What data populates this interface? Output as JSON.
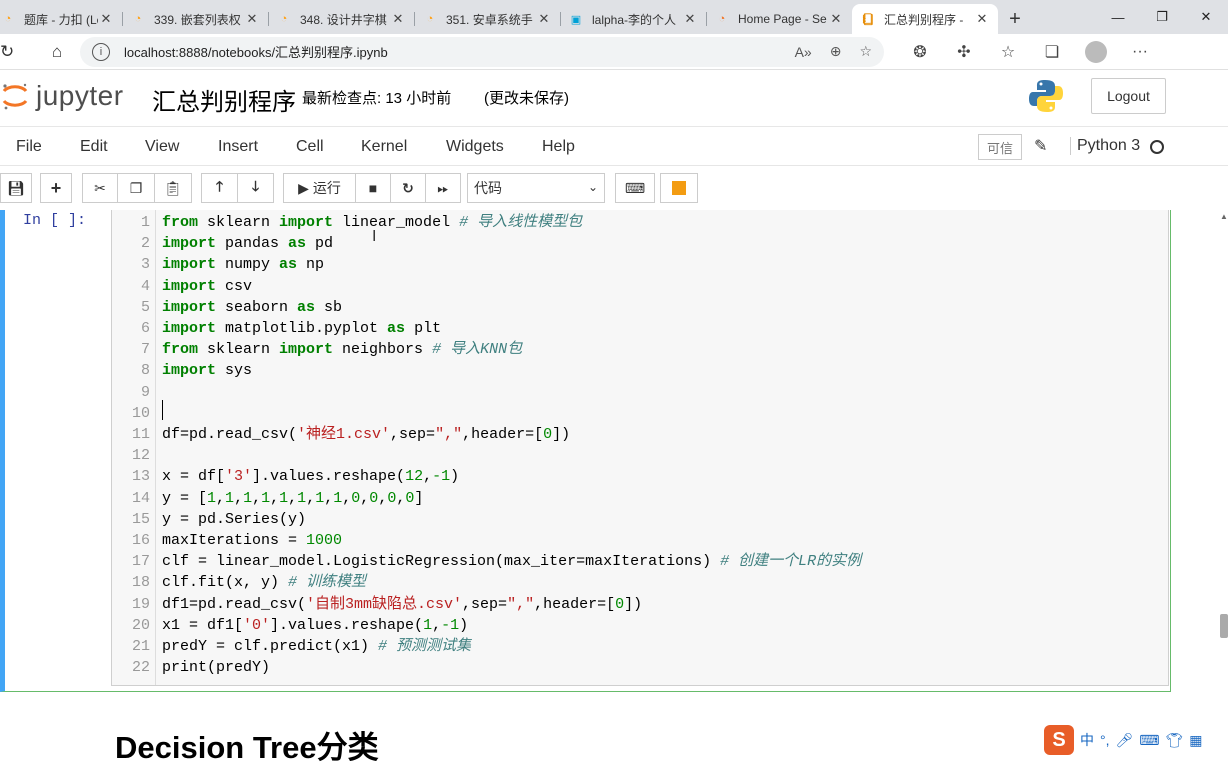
{
  "browser": {
    "tabs": [
      {
        "title": "题库 - 力扣 (Lee",
        "icon": "leetcode-icon",
        "color": "#ffa116"
      },
      {
        "title": "339. 嵌套列表权",
        "icon": "leetcode-icon",
        "color": "#ffa116"
      },
      {
        "title": "348. 设计井字棋",
        "icon": "leetcode-icon",
        "color": "#ffa116"
      },
      {
        "title": "351. 安卓系统手",
        "icon": "leetcode-icon",
        "color": "#ffa116"
      },
      {
        "title": "lalpha-李的个人",
        "icon": "bilibili-icon",
        "color": "#00a1d6"
      },
      {
        "title": "Home Page - Se",
        "icon": "jupyter-icon",
        "color": "#f37626"
      },
      {
        "title": "汇总判别程序 -",
        "icon": "notebook-icon",
        "color": "#e68a00",
        "active": true
      }
    ],
    "url": "localhost:8888/notebooks/汇总判别程序.ipynb"
  },
  "header": {
    "logo_text": "jupyter",
    "notebook_name": "汇总判别程序",
    "checkpoint": "最新检查点: 13 小时前",
    "unsaved": "(更改未保存)",
    "logout_label": "Logout"
  },
  "menubar": {
    "items": [
      "File",
      "Edit",
      "View",
      "Insert",
      "Cell",
      "Kernel",
      "Widgets",
      "Help"
    ],
    "trusted": "可信",
    "kernel_name": "Python 3"
  },
  "toolbar": {
    "run_label": "运行",
    "cell_type": "代码"
  },
  "cell": {
    "prompt": "In  [  ]:",
    "lines": [
      {
        "n": "1",
        "html": "<span class='kw'>from</span> sklearn <span class='kw'>import</span> linear_model <span class='cm'># 导入线性模型包</span>"
      },
      {
        "n": "2",
        "html": "<span class='kw'>import</span> pandas <span class='kw'>as</span> pd"
      },
      {
        "n": "3",
        "html": "<span class='kw'>import</span> numpy <span class='kw'>as</span> np"
      },
      {
        "n": "4",
        "html": "<span class='kw'>import</span> csv"
      },
      {
        "n": "5",
        "html": "<span class='kw'>import</span> seaborn <span class='kw'>as</span> sb"
      },
      {
        "n": "6",
        "html": "<span class='kw'>import</span> matplotlib.pyplot <span class='kw'>as</span> plt"
      },
      {
        "n": "7",
        "html": "<span class='kw'>from</span> sklearn <span class='kw'>import</span> neighbors <span class='cm'># 导入KNN包</span>"
      },
      {
        "n": "8",
        "html": "<span class='kw'>import</span> sys"
      },
      {
        "n": "9",
        "html": ""
      },
      {
        "n": "10",
        "html": ""
      },
      {
        "n": "11",
        "html": "df=pd.read_csv(<span class='st'>'神经1.csv'</span>,sep=<span class='st'>\",\"</span>,header=[<span class='nm'>0</span>])"
      },
      {
        "n": "12",
        "html": ""
      },
      {
        "n": "13",
        "html": "x = df[<span class='st'>'3'</span>].values.reshape(<span class='nm'>12</span>,<span class='nm'>-1</span>)"
      },
      {
        "n": "14",
        "html": "y = [<span class='nm'>1</span>,<span class='nm'>1</span>,<span class='nm'>1</span>,<span class='nm'>1</span>,<span class='nm'>1</span>,<span class='nm'>1</span>,<span class='nm'>1</span>,<span class='nm'>1</span>,<span class='nm'>0</span>,<span class='nm'>0</span>,<span class='nm'>0</span>,<span class='nm'>0</span>]"
      },
      {
        "n": "15",
        "html": "y = pd.Series(y)"
      },
      {
        "n": "16",
        "html": "maxIterations = <span class='nm'>1000</span>"
      },
      {
        "n": "17",
        "html": "clf = linear_model.LogisticRegression(max_iter=maxIterations) <span class='cm'># 创建一个LR的实例</span>"
      },
      {
        "n": "18",
        "html": "clf.fit(x, y) <span class='cm'># 训练模型</span>"
      },
      {
        "n": "19",
        "html": "df1=pd.read_csv(<span class='st'>'自制3mm缺陷总.csv'</span>,sep=<span class='st'>\",\"</span>,header=[<span class='nm'>0</span>])"
      },
      {
        "n": "20",
        "html": "x1 = df1[<span class='st'>'0'</span>].values.reshape(<span class='nm'>1</span>,<span class='nm'>-1</span>)"
      },
      {
        "n": "21",
        "html": "predY = clf.predict(x1) <span class='cm'># 预测测试集</span>"
      },
      {
        "n": "22",
        "html": "print(predY)"
      }
    ]
  },
  "markdown": {
    "heading": "Decision Tree分类"
  },
  "ime": {
    "label": "中"
  }
}
